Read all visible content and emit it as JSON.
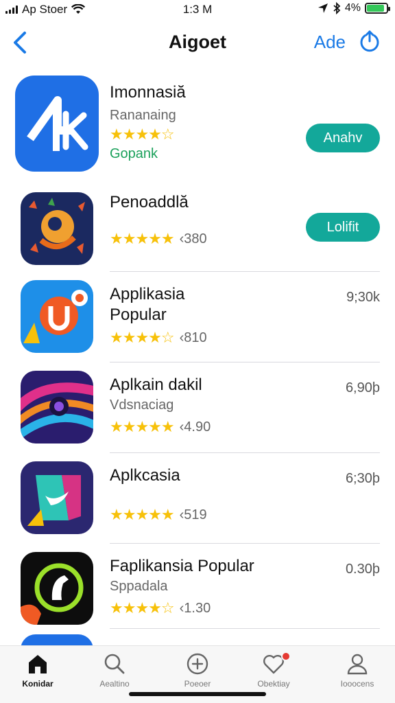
{
  "status_bar": {
    "carrier": "Ap Stoer",
    "time": "1:3 M",
    "battery": "4%",
    "battery_level": 0.9
  },
  "nav": {
    "title": "Aigoet",
    "action_label": "Ade"
  },
  "apps": [
    {
      "name": "Imonnasiă",
      "subtitle": "Rananaing",
      "stars": "★★★★☆",
      "extra": "Gopank",
      "button": "Anahv"
    },
    {
      "name": "Penoaddlă",
      "subtitle": "",
      "stars": "★★★★★",
      "rating": "‹380",
      "button": "Lolifit"
    },
    {
      "name": "Applikasia",
      "name2": "Popular",
      "stars": "★★★★☆",
      "rating": "‹810",
      "price": "9;30k"
    },
    {
      "name": "Aplkain dakil",
      "subtitle": "Vdsnaciag",
      "stars": "★★★★★",
      "rating": "‹4.90",
      "price": "6,90þ"
    },
    {
      "name": "Aplkcasia",
      "stars": "★★★★★",
      "rating": "‹519",
      "price": "6;30þ"
    },
    {
      "name": "Faplikansia Popular",
      "subtitle": "Sppadala",
      "stars": "★★★★☆",
      "rating": "‹1.30",
      "price": "0.30þ"
    }
  ],
  "tabs": [
    {
      "label": "Konidar",
      "icon": "home-icon",
      "active": true
    },
    {
      "label": "Aealtino",
      "icon": "search-icon"
    },
    {
      "label": "Poeoer",
      "icon": "add-icon"
    },
    {
      "label": "Obektiay",
      "icon": "heart-icon"
    },
    {
      "label": "Iooocens",
      "icon": "person-icon"
    }
  ],
  "colors": {
    "accent": "#1a7ae6",
    "button": "#13a89a",
    "stars": "#f7c10a",
    "badge": "#e53a32"
  }
}
